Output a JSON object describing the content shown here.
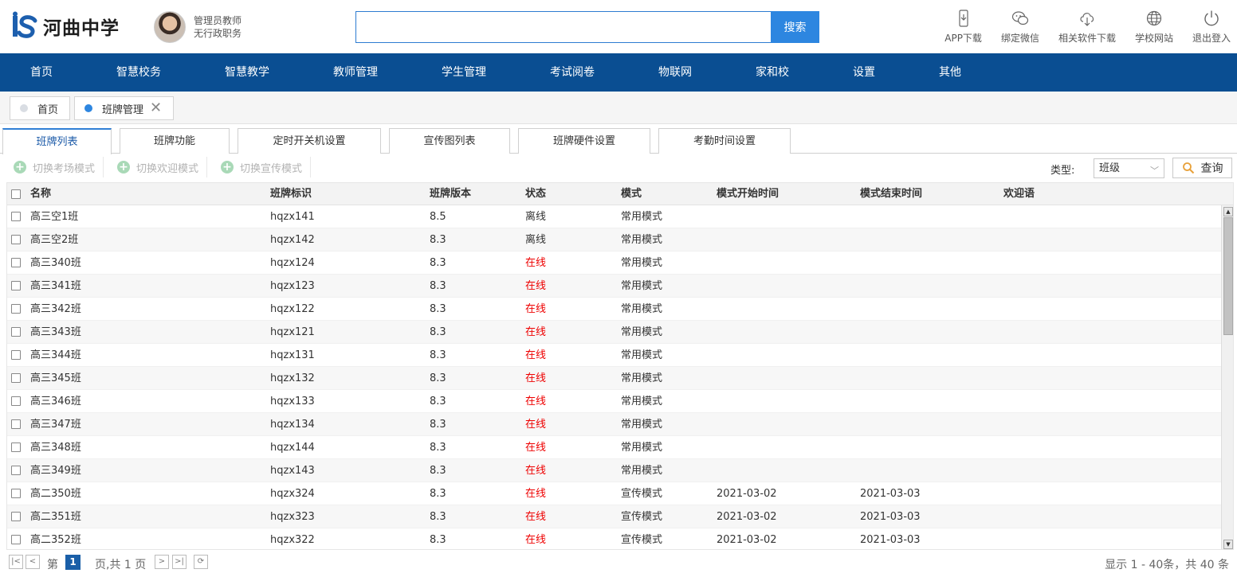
{
  "header": {
    "school_name": "河曲中学",
    "user_role": "管理员教师",
    "user_duty": "无行政职务",
    "search_placeholder": "",
    "search_button": "搜索",
    "tools": [
      {
        "label": "APP下载",
        "icon": "phone-download-icon"
      },
      {
        "label": "绑定微信",
        "icon": "wechat-icon"
      },
      {
        "label": "相关软件下载",
        "icon": "cloud-download-icon"
      },
      {
        "label": "学校网站",
        "icon": "globe-icon"
      },
      {
        "label": "退出登入",
        "icon": "power-icon"
      }
    ]
  },
  "nav": {
    "items": [
      "首页",
      "智慧校务",
      "智慧教学",
      "教师管理",
      "学生管理",
      "考试阅卷",
      "物联网",
      "家和校",
      "设置",
      "其他"
    ]
  },
  "page_tabs": [
    {
      "label": "首页",
      "active": false
    },
    {
      "label": "班牌管理",
      "active": true
    }
  ],
  "sub_tabs": [
    "班牌列表",
    "班牌功能",
    "定时开关机设置",
    "宣传图列表",
    "班牌硬件设置",
    "考勤时间设置"
  ],
  "toolbar": {
    "buttons": [
      "切换考场模式",
      "切换欢迎模式",
      "切换宣传模式"
    ],
    "filter_label": "类型:",
    "filter_value": "班级",
    "query_button": "查询"
  },
  "table": {
    "columns": [
      "名称",
      "班牌标识",
      "班牌版本",
      "状态",
      "模式",
      "模式开始时间",
      "模式结束时间",
      "欢迎语"
    ],
    "rows": [
      [
        "高三空1班",
        "hqzx141",
        "8.5",
        "离线",
        "常用模式",
        "",
        "",
        ""
      ],
      [
        "高三空2班",
        "hqzx142",
        "8.3",
        "离线",
        "常用模式",
        "",
        "",
        ""
      ],
      [
        "高三340班",
        "hqzx124",
        "8.3",
        "在线",
        "常用模式",
        "",
        "",
        ""
      ],
      [
        "高三341班",
        "hqzx123",
        "8.3",
        "在线",
        "常用模式",
        "",
        "",
        ""
      ],
      [
        "高三342班",
        "hqzx122",
        "8.3",
        "在线",
        "常用模式",
        "",
        "",
        ""
      ],
      [
        "高三343班",
        "hqzx121",
        "8.3",
        "在线",
        "常用模式",
        "",
        "",
        ""
      ],
      [
        "高三344班",
        "hqzx131",
        "8.3",
        "在线",
        "常用模式",
        "",
        "",
        ""
      ],
      [
        "高三345班",
        "hqzx132",
        "8.3",
        "在线",
        "常用模式",
        "",
        "",
        ""
      ],
      [
        "高三346班",
        "hqzx133",
        "8.3",
        "在线",
        "常用模式",
        "",
        "",
        ""
      ],
      [
        "高三347班",
        "hqzx134",
        "8.3",
        "在线",
        "常用模式",
        "",
        "",
        ""
      ],
      [
        "高三348班",
        "hqzx144",
        "8.3",
        "在线",
        "常用模式",
        "",
        "",
        ""
      ],
      [
        "高三349班",
        "hqzx143",
        "8.3",
        "在线",
        "常用模式",
        "",
        "",
        ""
      ],
      [
        "高二350班",
        "hqzx324",
        "8.3",
        "在线",
        "宣传模式",
        "2021-03-02",
        "2021-03-03",
        ""
      ],
      [
        "高二351班",
        "hqzx323",
        "8.3",
        "在线",
        "宣传模式",
        "2021-03-02",
        "2021-03-03",
        ""
      ],
      [
        "高二352班",
        "hqzx322",
        "8.3",
        "在线",
        "宣传模式",
        "2021-03-02",
        "2021-03-03",
        ""
      ]
    ]
  },
  "pager": {
    "page_prefix": "第",
    "current_page": "1",
    "page_suffix": "页,共 1 页",
    "summary": "显示 1 - 40条，共 40 条"
  },
  "colors": {
    "nav_bg": "#0a4e92",
    "accent": "#2d86e0",
    "online": "#e00000"
  }
}
